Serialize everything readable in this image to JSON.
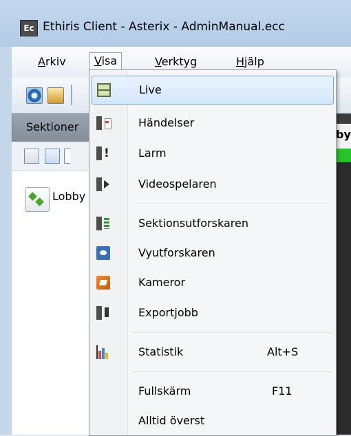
{
  "window": {
    "app_icon_text": "Ec",
    "title": "Ethiris Client - Asterix - AdminManual.ecc"
  },
  "menubar": {
    "items": [
      {
        "name": "Arkiv",
        "underline": "A",
        "rest": "rkiv"
      },
      {
        "name": "Visa",
        "underline": "V",
        "rest": "isa",
        "open": true
      },
      {
        "name": "Verktyg",
        "underline": "V",
        "rest": "erktyg"
      },
      {
        "name": "Hjälp",
        "underline": "H",
        "rest": "jälp"
      }
    ]
  },
  "toolbar": {
    "buttons": [
      "gear-icon",
      "folder-icon"
    ]
  },
  "sections_panel": {
    "header": "Sektioner",
    "tree_items": [
      {
        "label": "Lobby"
      }
    ]
  },
  "right_pane": {
    "tab_label": "by"
  },
  "visa_menu": {
    "items": [
      {
        "label": "Live",
        "icon": "live-icon",
        "highlighted": true
      },
      {
        "label": "Händelser",
        "icon": "events-icon"
      },
      {
        "label": "Larm",
        "icon": "alarm-icon"
      },
      {
        "label": "Videospelaren",
        "icon": "video-player-icon"
      },
      {
        "label": "Sektionsutforskaren",
        "icon": "section-explorer-icon"
      },
      {
        "label": "Vyutforskaren",
        "icon": "view-explorer-icon"
      },
      {
        "label": "Kameror",
        "icon": "cameras-icon"
      },
      {
        "label": "Exportjobb",
        "icon": "export-job-icon"
      },
      {
        "label": "Statistik",
        "icon": "statistics-icon",
        "shortcut": "Alt+S"
      },
      {
        "label": "Fullskärm",
        "icon": "",
        "shortcut": "F11"
      },
      {
        "label": "Alltid överst",
        "icon": ""
      }
    ]
  }
}
